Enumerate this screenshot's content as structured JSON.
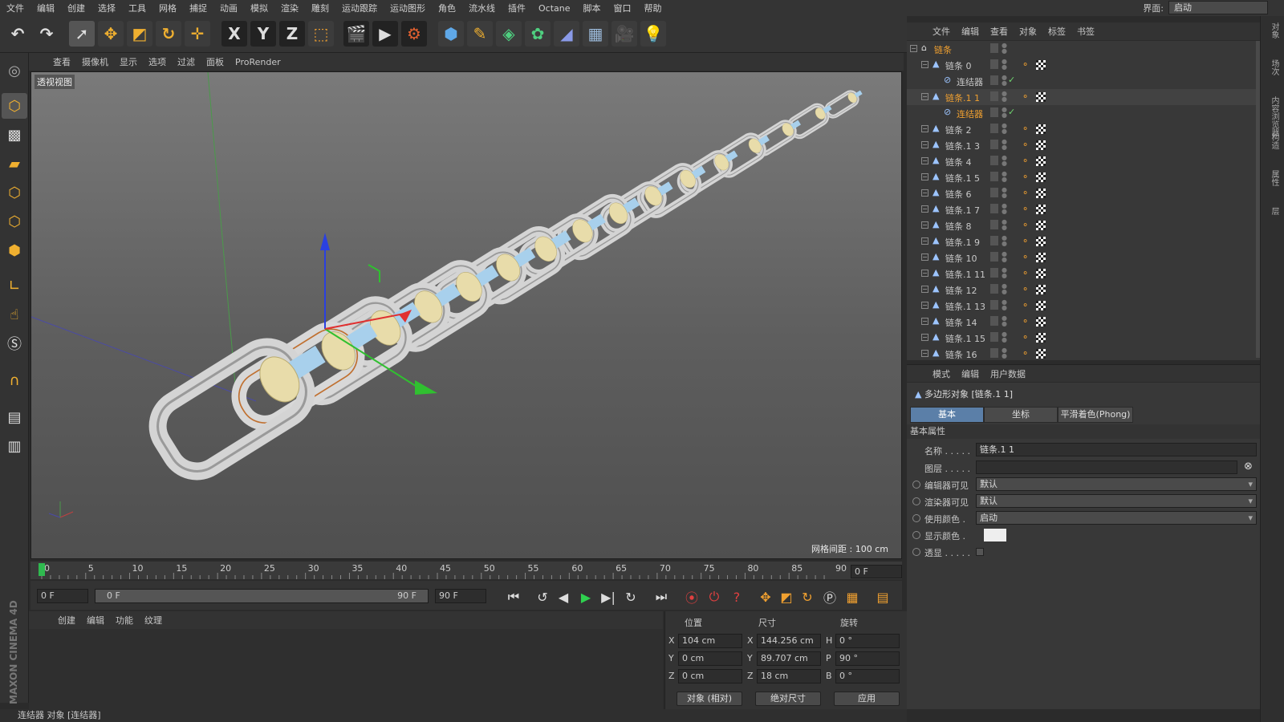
{
  "menubar": {
    "items": [
      "文件",
      "编辑",
      "创建",
      "选择",
      "工具",
      "网格",
      "捕捉",
      "动画",
      "模拟",
      "渲染",
      "雕刻",
      "运动跟踪",
      "运动图形",
      "角色",
      "流水线",
      "插件",
      "Octane",
      "脚本",
      "窗口",
      "帮助"
    ],
    "interface_label": "界面:",
    "interface_value": "启动"
  },
  "toolbar": {
    "axis_x": "X",
    "axis_y": "Y",
    "axis_z": "Z"
  },
  "viewport": {
    "menu": [
      "查看",
      "摄像机",
      "显示",
      "选项",
      "过滤",
      "面板",
      "ProRender"
    ],
    "label": "透视视图",
    "grid_spacing": "网格间距 : 100 cm"
  },
  "timeline": {
    "ticks": [
      "0",
      "5",
      "10",
      "15",
      "20",
      "25",
      "30",
      "35",
      "40",
      "45",
      "50",
      "55",
      "60",
      "65",
      "70",
      "75",
      "80",
      "85",
      "90"
    ],
    "current_frame": "0 F",
    "start_field": "0 F",
    "range_start": "0 F",
    "range_end": "90 F",
    "end_field": "90 F"
  },
  "material_manager": {
    "menu": [
      "创建",
      "编辑",
      "功能",
      "纹理"
    ]
  },
  "brand": "MAXON CINEMA 4D",
  "coords": {
    "headers": {
      "position": "位置",
      "size": "尺寸",
      "rotation": "旋转"
    },
    "rows": [
      {
        "axis": "X",
        "pos": "104 cm",
        "size_axis": "X",
        "size": "144.256 cm",
        "rot_axis": "H",
        "rot": "0 °"
      },
      {
        "axis": "Y",
        "pos": "0 cm",
        "size_axis": "Y",
        "size": "89.707 cm",
        "rot_axis": "P",
        "rot": "90 °"
      },
      {
        "axis": "Z",
        "pos": "0 cm",
        "size_axis": "Z",
        "size": "18 cm",
        "rot_axis": "B",
        "rot": "0 °"
      }
    ],
    "mode_select": "对象 (相对)",
    "size_select": "绝对尺寸",
    "apply": "应用"
  },
  "status": "连结器 对象 [连结器]",
  "object_manager": {
    "menu": [
      "文件",
      "编辑",
      "查看",
      "对象",
      "标签",
      "书签"
    ],
    "objects": [
      {
        "name": "链条",
        "level": 0,
        "type": "null",
        "color": "#f0a030"
      },
      {
        "name": "链条 0",
        "level": 1,
        "type": "poly",
        "color": "#c8c8c8",
        "tags": true
      },
      {
        "name": "连结器",
        "level": 2,
        "type": "connector",
        "color": "#c8c8c8",
        "check": true
      },
      {
        "name": "链条.1 1",
        "level": 1,
        "type": "poly",
        "color": "#f0a030",
        "tags": true
      },
      {
        "name": "连结器",
        "level": 2,
        "type": "connector",
        "color": "#f0a030",
        "check": true
      },
      {
        "name": "链条 2",
        "level": 1,
        "type": "poly",
        "color": "#c8c8c8",
        "tags": true
      },
      {
        "name": "链条.1 3",
        "level": 1,
        "type": "poly",
        "color": "#c8c8c8",
        "tags": true
      },
      {
        "name": "链条 4",
        "level": 1,
        "type": "poly",
        "color": "#c8c8c8",
        "tags": true
      },
      {
        "name": "链条.1 5",
        "level": 1,
        "type": "poly",
        "color": "#c8c8c8",
        "tags": true
      },
      {
        "name": "链条 6",
        "level": 1,
        "type": "poly",
        "color": "#c8c8c8",
        "tags": true
      },
      {
        "name": "链条.1 7",
        "level": 1,
        "type": "poly",
        "color": "#c8c8c8",
        "tags": true
      },
      {
        "name": "链条 8",
        "level": 1,
        "type": "poly",
        "color": "#c8c8c8",
        "tags": true
      },
      {
        "name": "链条.1 9",
        "level": 1,
        "type": "poly",
        "color": "#c8c8c8",
        "tags": true
      },
      {
        "name": "链条 10",
        "level": 1,
        "type": "poly",
        "color": "#c8c8c8",
        "tags": true
      },
      {
        "name": "链条.1 11",
        "level": 1,
        "type": "poly",
        "color": "#c8c8c8",
        "tags": true
      },
      {
        "name": "链条 12",
        "level": 1,
        "type": "poly",
        "color": "#c8c8c8",
        "tags": true
      },
      {
        "name": "链条.1 13",
        "level": 1,
        "type": "poly",
        "color": "#c8c8c8",
        "tags": true
      },
      {
        "name": "链条 14",
        "level": 1,
        "type": "poly",
        "color": "#c8c8c8",
        "tags": true
      },
      {
        "name": "链条.1 15",
        "level": 1,
        "type": "poly",
        "color": "#c8c8c8",
        "tags": true
      },
      {
        "name": "链条 16",
        "level": 1,
        "type": "poly",
        "color": "#c8c8c8",
        "tags": true
      }
    ]
  },
  "attribute_manager": {
    "menu": [
      "模式",
      "编辑",
      "用户数据"
    ],
    "object_title": "多边形对象 [链条.1 1]",
    "tabs": [
      "基本",
      "坐标",
      "平滑着色(Phong)"
    ],
    "section": "基本属性",
    "name_label": "名称 . . . . .",
    "name_value": "链条.1 1",
    "layer_label": "图层 . . . . .",
    "editor_visible_label": "编辑器可见",
    "editor_visible_value": "默认",
    "render_visible_label": "渲染器可见",
    "render_visible_value": "默认",
    "use_color_label": "使用颜色 .",
    "use_color_value": "启动",
    "display_color_label": "显示颜色 .",
    "xray_label": "透显 . . . . ."
  },
  "right_strip": [
    "对象",
    "场次",
    "内容浏览器",
    "构造",
    "属性",
    "层"
  ]
}
